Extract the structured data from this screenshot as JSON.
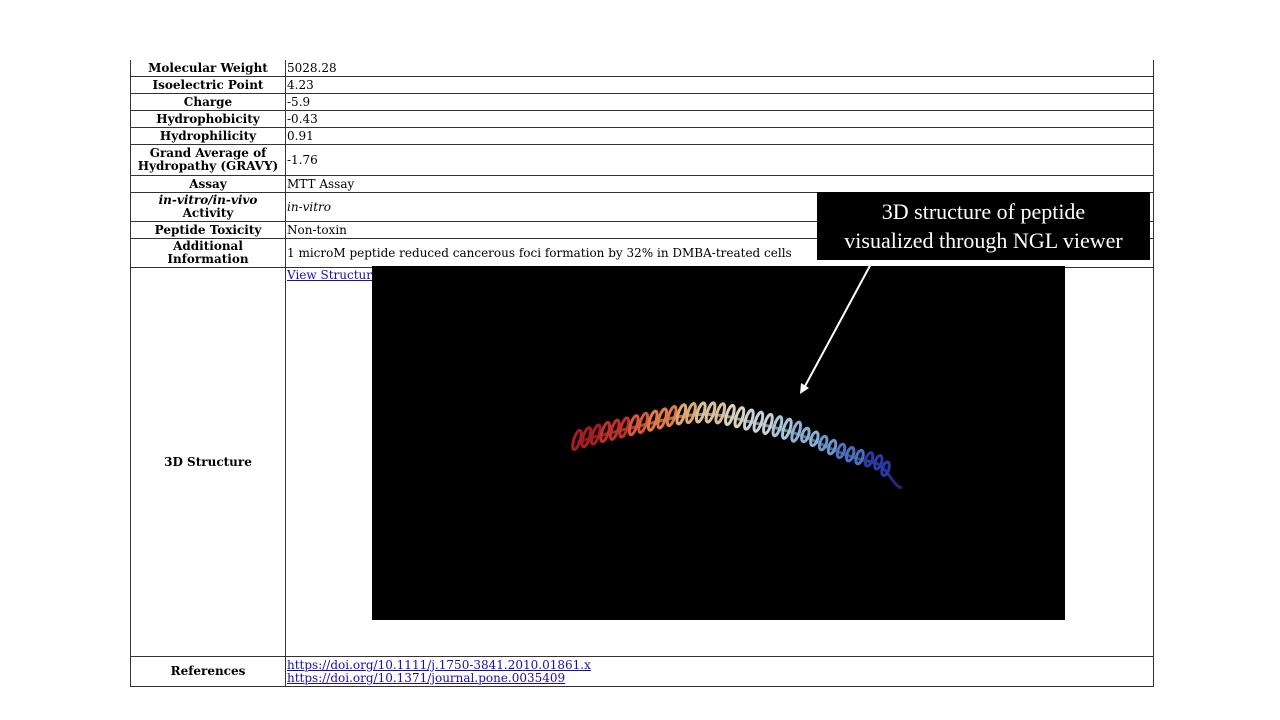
{
  "rows": [
    {
      "key": "Molecular Weight",
      "value": "5028.28"
    },
    {
      "key": "Isoelectric Point",
      "value": "4.23"
    },
    {
      "key": "Charge",
      "value": "-5.9"
    },
    {
      "key": "Hydrophobicity",
      "value": "-0.43"
    },
    {
      "key": "Hydrophilicity",
      "value": "0.91"
    },
    {
      "key": "Grand Average of Hydropathy (GRAVY)",
      "value": "-1.76"
    },
    {
      "key": "Assay",
      "value": "MTT Assay"
    },
    {
      "key_italic": "in-vitro/in-vivo",
      "key_rest": " Activity",
      "value": "in-vitro"
    },
    {
      "key": "Peptide Toxicity",
      "value": "Non-toxin"
    },
    {
      "key": "Additional Information",
      "value": "1 microM peptide reduced cancerous foci formation by 32% in DMBA-treated cells"
    }
  ],
  "structure": {
    "key": "3D Structure",
    "link": "View Structure"
  },
  "references": {
    "key": "References",
    "links": [
      "https://doi.org/10.1111/j.1750-3841.2010.01861.x",
      "https://doi.org/10.1371/journal.pone.0035409"
    ]
  },
  "callout": {
    "line1": "3D structure of peptide",
    "line2": "visualized through NGL viewer"
  },
  "colors": {
    "link": "#1a0dab",
    "viewer_bg": "#000000",
    "helix_start": "#b22222",
    "helix_mid": "#d8d0b8",
    "helix_end": "#3040b0"
  }
}
